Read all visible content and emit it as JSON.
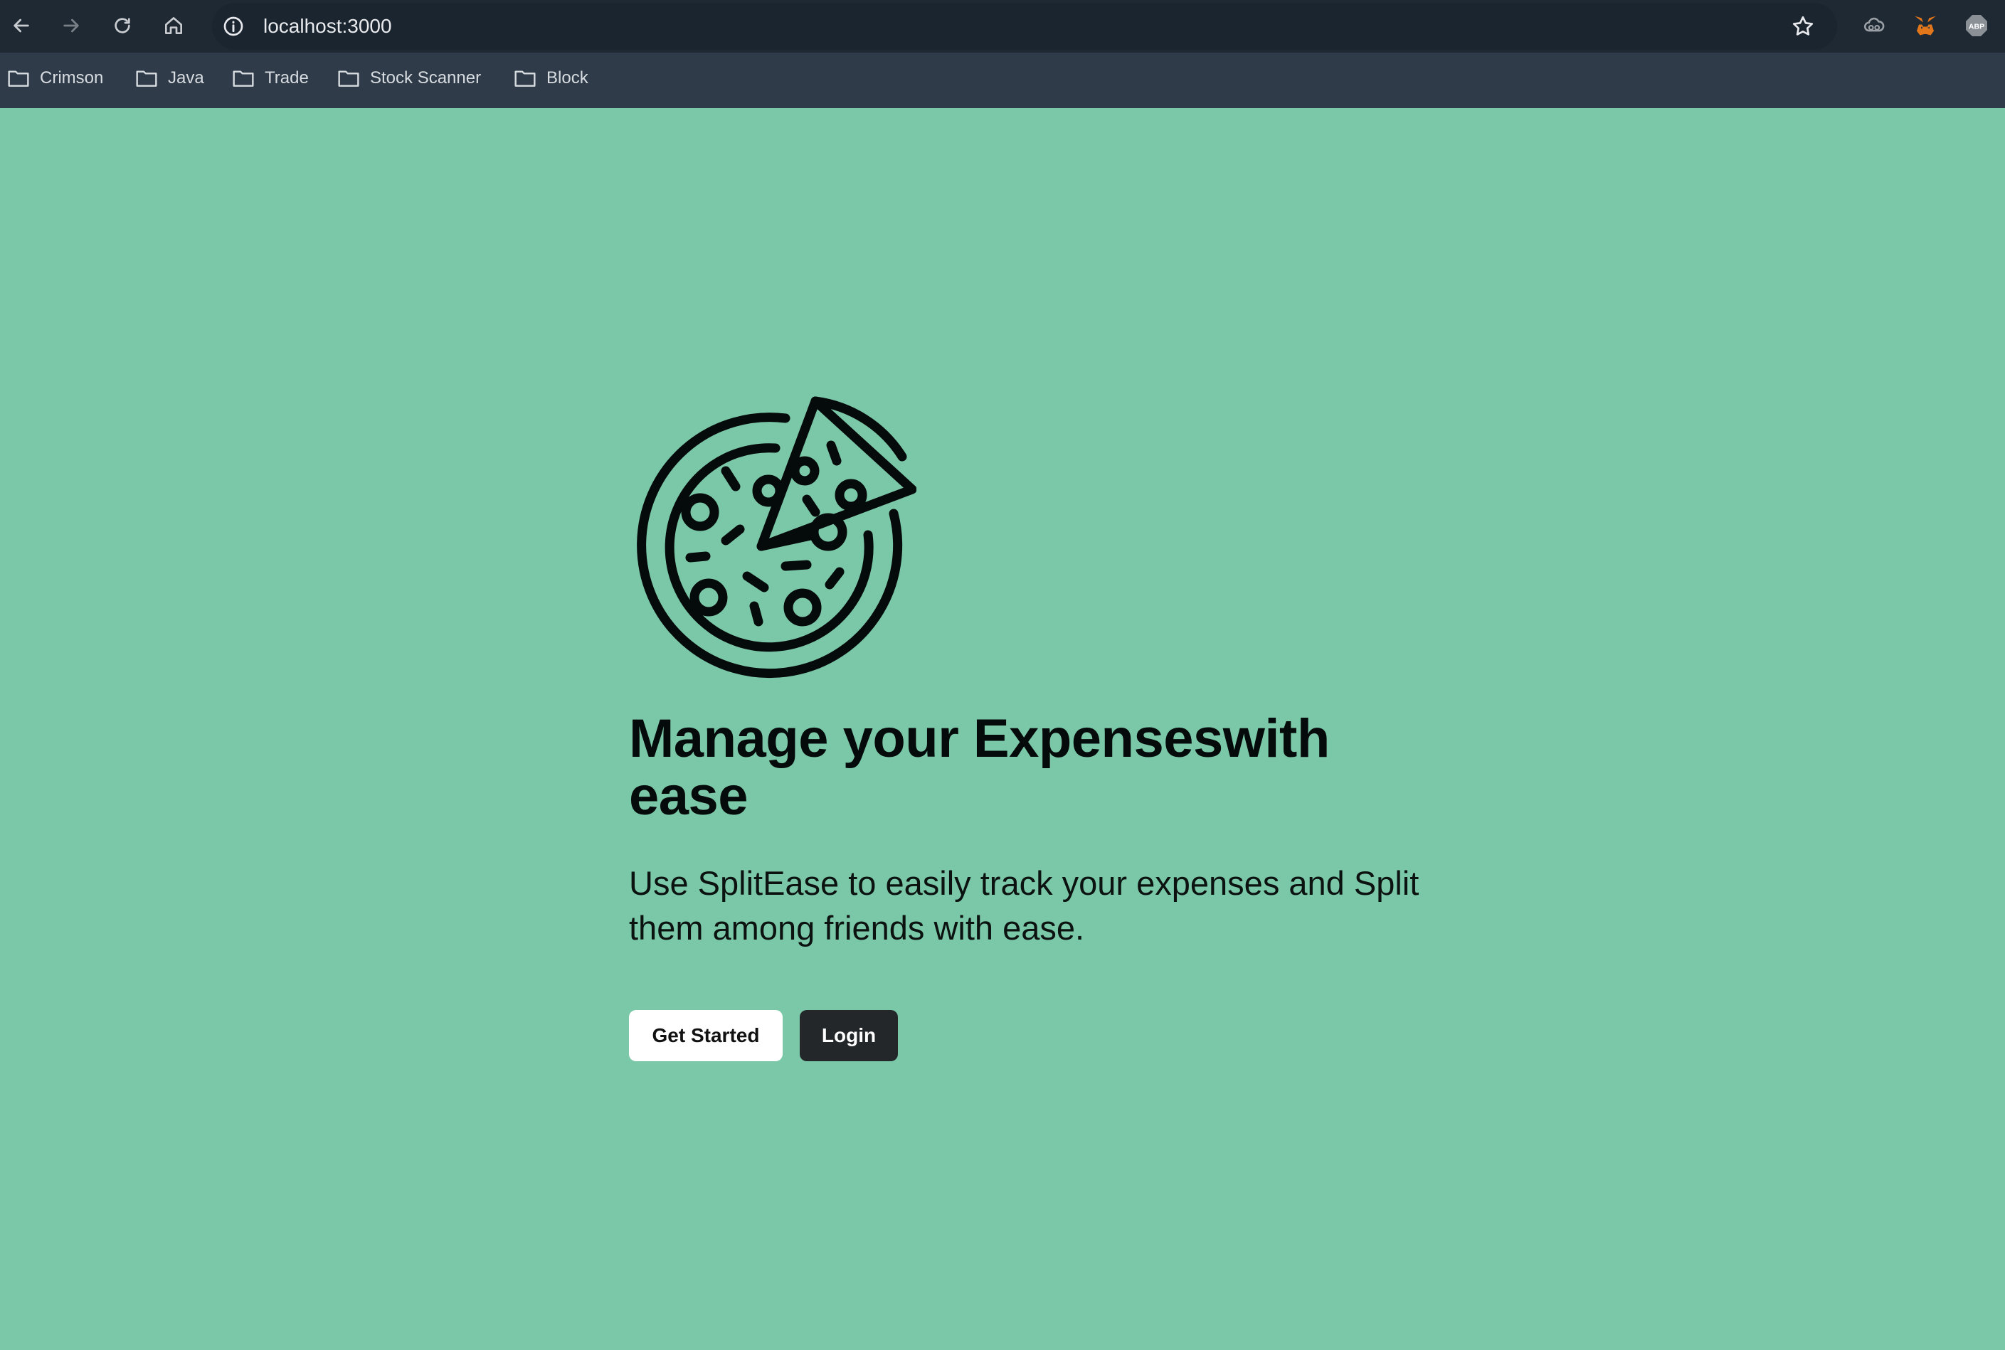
{
  "browser": {
    "url": "localhost:3000",
    "bookmarks": [
      "Crimson",
      "Java",
      "Trade",
      "Stock Scanner",
      "Block"
    ],
    "extensions": [
      "cloud-extension-icon",
      "metamask-fox-icon",
      "adblock-plus-icon"
    ],
    "abp_text": "ABP"
  },
  "hero": {
    "icon": "pizza-icon",
    "headline_part1": "Manage your ",
    "headline_highlight": "Expenses",
    "headline_part2": "with ease",
    "subtext": "Use SplitEase to easily track your expenses and Split them among friends with ease.",
    "get_started_label": "Get Started",
    "login_label": "Login"
  },
  "colors": {
    "background": "#7bc8a9",
    "primary_button": "#ffffff",
    "dark_button": "#24272a",
    "text": "#050a0a"
  }
}
